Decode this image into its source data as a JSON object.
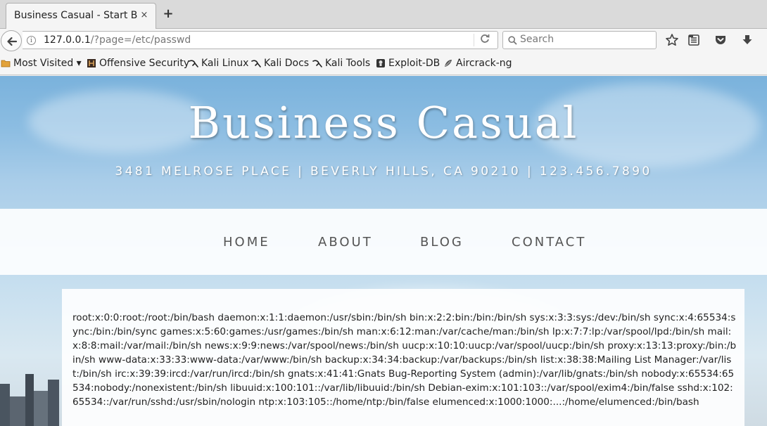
{
  "browser": {
    "tab_title": "Business Casual - Start B...",
    "tab_close": "×",
    "new_tab": "+",
    "url_host": "127.0.0.1",
    "url_path": "/?page=/etc/passwd",
    "search_placeholder": "Search"
  },
  "bookmarks": {
    "items": [
      {
        "label": "Most Visited ▾",
        "icon": "folder-icon"
      },
      {
        "label": "Offensive Security",
        "icon": "offsec-icon"
      },
      {
        "label": "Kali Linux",
        "icon": "kali-icon"
      },
      {
        "label": "Kali Docs",
        "icon": "kali-icon"
      },
      {
        "label": "Kali Tools",
        "icon": "kali-icon"
      },
      {
        "label": "Exploit-DB",
        "icon": "exploitdb-icon"
      },
      {
        "label": "Aircrack-ng",
        "icon": "aircrack-icon"
      }
    ]
  },
  "site": {
    "title": "Business Casual",
    "address": "3481 MELROSE PLACE | BEVERLY HILLS, CA 90210 | 123.456.7890",
    "nav": [
      "HOME",
      "ABOUT",
      "BLOG",
      "CONTACT"
    ],
    "content": "root:x:0:0:root:/root:/bin/bash daemon:x:1:1:daemon:/usr/sbin:/bin/sh bin:x:2:2:bin:/bin:/bin/sh sys:x:3:3:sys:/dev:/bin/sh sync:x:4:65534:sync:/bin:/bin/sync games:x:5:60:games:/usr/games:/bin/sh man:x:6:12:man:/var/cache/man:/bin/sh lp:x:7:7:lp:/var/spool/lpd:/bin/sh mail:x:8:8:mail:/var/mail:/bin/sh news:x:9:9:news:/var/spool/news:/bin/sh uucp:x:10:10:uucp:/var/spool/uucp:/bin/sh proxy:x:13:13:proxy:/bin:/bin/sh www-data:x:33:33:www-data:/var/www:/bin/sh backup:x:34:34:backup:/var/backups:/bin/sh list:x:38:38:Mailing List Manager:/var/list:/bin/sh irc:x:39:39:ircd:/var/run/ircd:/bin/sh gnats:x:41:41:Gnats Bug-Reporting System (admin):/var/lib/gnats:/bin/sh nobody:x:65534:65534:nobody:/nonexistent:/bin/sh libuuid:x:100:101::/var/lib/libuuid:/bin/sh Debian-exim:x:101:103::/var/spool/exim4:/bin/false sshd:x:102:65534::/var/run/sshd:/usr/sbin/nologin ntp:x:103:105::/home/ntp:/bin/false elumenced:x:1000:1000:...:/home/elumenced:/bin/bash"
  }
}
